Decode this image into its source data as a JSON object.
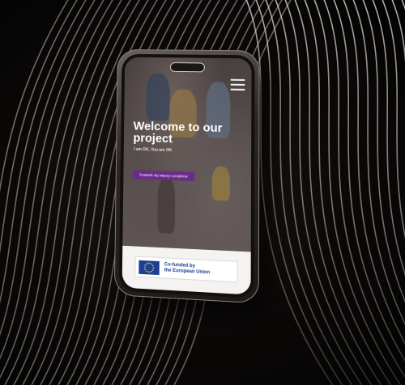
{
  "hero": {
    "title": "Welcome to our project",
    "subtitle": "I am OK, You are OK",
    "cta_label": "Dowiedz się więcej o projekcie"
  },
  "footer": {
    "eu_line1": "Co-funded by",
    "eu_line2": "the European Union"
  },
  "icons": {
    "menu": "hamburger-menu-icon",
    "flag": "eu-flag-icon"
  },
  "colors": {
    "cta": "#6a2c8a",
    "eu_blue": "#1c3f95",
    "eu_gold": "#f7d000"
  }
}
